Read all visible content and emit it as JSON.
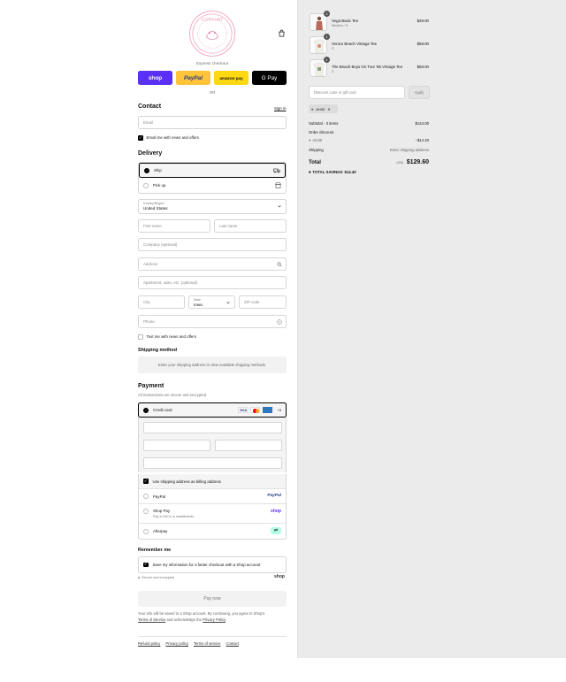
{
  "header": {
    "logo_alt": "COTH ART",
    "bag_icon": "shopping-bag-icon"
  },
  "express": {
    "label": "Express checkout",
    "shop_label": "shop",
    "paypal_label": "PayPal",
    "amazon_label": "amazon pay",
    "gpay_label": "G Pay",
    "or_label": "OR"
  },
  "contact": {
    "title": "Contact",
    "signin": "Sign in",
    "email_placeholder": "Email",
    "news_label": "Email me with news and offers"
  },
  "delivery": {
    "title": "Delivery",
    "ship_label": "Ship",
    "pickup_label": "Pick up",
    "country_label": "Country/Region",
    "country_value": "United States",
    "first_name": "First name",
    "last_name": "Last name",
    "company": "Company (optional)",
    "address": "Address",
    "apartment": "Apartment, suite, etc. (optional)",
    "city": "City",
    "state_label": "State",
    "state_value": "Iowa",
    "zip": "ZIP code",
    "phone": "Phone",
    "text_label": "Text me with news and offers"
  },
  "shipping": {
    "title": "Shipping method",
    "note": "Enter your shipping address to view available shipping methods."
  },
  "payment": {
    "title": "Payment",
    "subtitle": "All transactions are secure and encrypted.",
    "credit_card": "Credit card",
    "visa": "VISA",
    "more": "+5",
    "billing_label": "Use shipping address as billing address",
    "paypal": "PayPal",
    "shoppay": "Shop Pay",
    "shoppay_sub": "Pay in full or in installments",
    "afterpay": "Afterpay",
    "paypal_brand": "PayPal",
    "shop_brand": "shop"
  },
  "remember": {
    "title": "Remember me",
    "save_label": "Save my information for a faster checkout with a Shop account",
    "secure": "Secure and encrypted",
    "shop_brand": "shop"
  },
  "paynow": "Pay now",
  "legal": {
    "text1": "Your info will be saved to a Shop account. By continuing, you agree to Shop's",
    "tos": "Terms of Service",
    "text2": "and acknowledge the",
    "privacy": "Privacy Policy",
    "end": "."
  },
  "footer": {
    "refund": "Refund policy",
    "privacy": "Privacy policy",
    "terms": "Terms of service",
    "contact": "Contact"
  },
  "cart": {
    "items": [
      {
        "name": "Vega Basic Tee",
        "variant": "Medina / S",
        "price": "$28.00",
        "qty": "1"
      },
      {
        "name": "Venice Beach Vintage Tee",
        "variant": "S",
        "price": "$58.00",
        "qty": "1"
      },
      {
        "name": "The Beach Boys On Tour '85 Vintage Tee",
        "variant": "S",
        "price": "$58.00",
        "qty": "1"
      }
    ],
    "discount_placeholder": "Discount code or gift card",
    "apply": "Apply",
    "tag": "AH30",
    "subtotal_label": "Subtotal · 3 items",
    "subtotal": "$144.00",
    "order_discount": "Order discount",
    "discount_code": "AH30",
    "discount_value": "−$14.40",
    "shipping_label": "Shipping",
    "shipping_value": "Enter shipping address",
    "total_label": "Total",
    "currency": "USD",
    "total": "$129.60",
    "savings_label": "TOTAL SAVINGS",
    "savings": "$14.40"
  }
}
